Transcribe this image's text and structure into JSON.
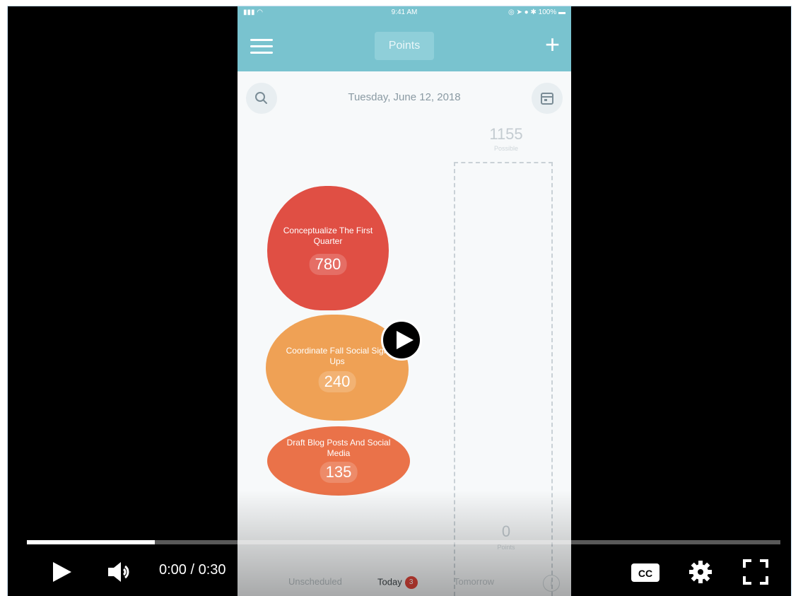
{
  "phone": {
    "status": {
      "signal": "▮▮▮ ◠",
      "time": "9:41 AM",
      "right": "◎ ➤ ● ✱ 100% ▬"
    },
    "nav": {
      "title": "Points"
    },
    "date": "Tuesday, June 12, 2018",
    "possible": {
      "value": "1155",
      "label": "Possible"
    },
    "points": {
      "value": "0",
      "label": "Points"
    },
    "tasks": [
      {
        "title": "Conceptualize The First Quarter",
        "points": "780"
      },
      {
        "title": "Coordinate Fall Social Sign Ups",
        "points": "240"
      },
      {
        "title": "Draft Blog Posts And Social Media",
        "points": "135"
      }
    ],
    "tabs": {
      "unscheduled": "Unscheduled",
      "today": "Today",
      "today_badge": "3",
      "tomorrow": "Tomorrow",
      "info": "i"
    }
  },
  "player": {
    "time_display": "0:00 / 0:30",
    "progress_fraction": 0.17,
    "icons": [
      "play-icon",
      "volume-icon",
      "captions-icon",
      "settings-icon",
      "fullscreen-icon",
      "big-play-icon"
    ]
  },
  "colors": {
    "nav_teal": "#79c3cf",
    "task_red": "#e04f44",
    "task_orange": "#efa155",
    "task_coral": "#ea7249"
  }
}
